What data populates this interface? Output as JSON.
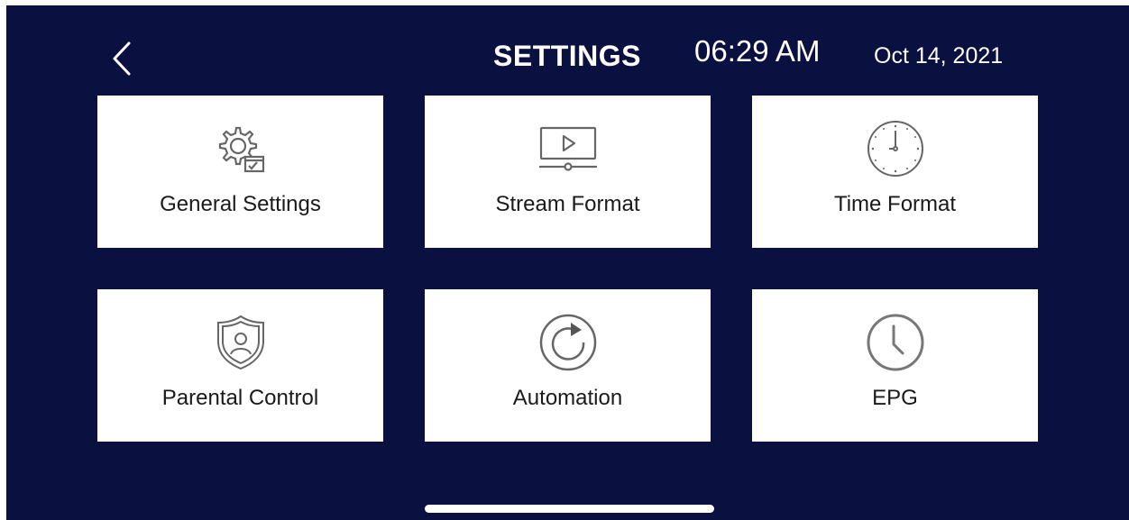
{
  "header": {
    "title": "SETTINGS",
    "time": "06:29 AM",
    "date": "Oct 14, 2021"
  },
  "tiles": [
    {
      "label": "General Settings",
      "icon": "gear-settings-icon"
    },
    {
      "label": "Stream Format",
      "icon": "video-player-icon"
    },
    {
      "label": "Time Format",
      "icon": "clock-face-icon"
    },
    {
      "label": "Parental Control",
      "icon": "shield-user-icon"
    },
    {
      "label": "Automation",
      "icon": "refresh-arrow-icon"
    },
    {
      "label": "EPG",
      "icon": "clock-icon"
    }
  ],
  "colors": {
    "background": "#0a1140",
    "tile": "#ffffff",
    "icon_stroke": "#666666",
    "text_dark": "#1a1a1a"
  }
}
